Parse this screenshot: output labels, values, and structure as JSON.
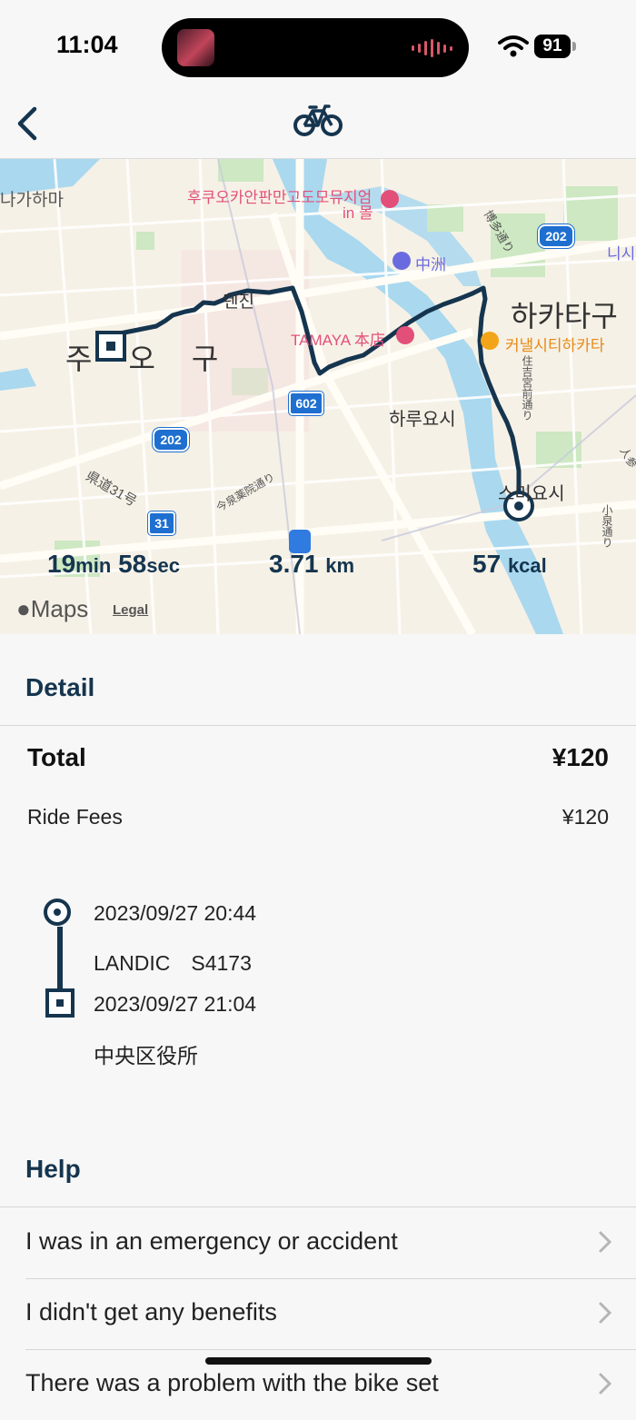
{
  "status": {
    "time": "11:04",
    "battery": "91"
  },
  "nav": {
    "back_icon": "chevron-left-icon",
    "title_icon": "bicycle-icon"
  },
  "map": {
    "labels": {
      "nakagahama": "나가하마",
      "fukuoka_museum": "후쿠오카안판만고도모뮤지엄",
      "in_mall": "in 몰",
      "nakasu": "中洲",
      "hakata_road": "博多通り",
      "hakata_ku": "하카타구",
      "tenjin": "덴진",
      "tamaya": "TAMAYA 本店",
      "canal_city": "커낼시티하카타",
      "chuo_ku": "주오구",
      "haruyoshi": "하루요시",
      "sumiyoshi_st": "住吉宮前通り",
      "sumiyoshi": "스미요시",
      "kendo31": "県道31号",
      "imaizumi": "今泉薬院通り",
      "nishi": "니시",
      "right_edge_1": "人参",
      "right_edge_2": "小泉通り"
    },
    "shields": {
      "r202a": "202",
      "r202b": "202",
      "r602": "602",
      "r31": "31"
    },
    "stats": {
      "duration_min": "19",
      "duration_min_unit": "min",
      "duration_sec": "58",
      "duration_sec_unit": "sec",
      "distance": "3.71",
      "distance_unit": "km",
      "calories": "57",
      "calories_unit": "kcal"
    },
    "attribution": {
      "maps": "Maps",
      "legal": "Legal"
    }
  },
  "detail": {
    "title": "Detail",
    "total_label": "Total",
    "total_value": "¥120",
    "fee_label": "Ride Fees",
    "fee_value": "¥120",
    "trip": {
      "start_time": "2023/09/27 20:44",
      "bike_id": "LANDIC　S4173",
      "end_time": "2023/09/27 21:04",
      "end_location": "中央区役所"
    }
  },
  "help": {
    "title": "Help",
    "items": [
      {
        "label": "I was in an emergency or accident"
      },
      {
        "label": "I didn't get any benefits"
      },
      {
        "label": "There was a problem with the bike set"
      }
    ]
  }
}
